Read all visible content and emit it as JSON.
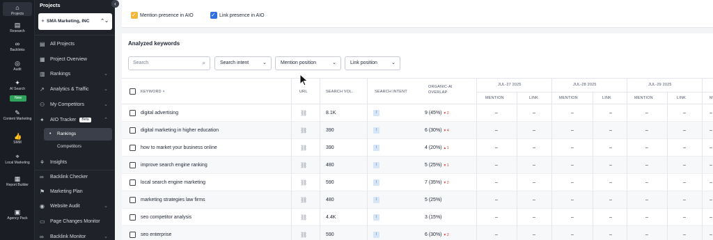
{
  "rail": [
    {
      "label": "Projects",
      "icon": "home-icon",
      "glyph": "⌂"
    },
    {
      "label": "Research",
      "icon": "research-icon",
      "glyph": "▤"
    },
    {
      "label": "Backlinks",
      "icon": "link-icon",
      "glyph": "∞"
    },
    {
      "label": "Audit",
      "icon": "audit-icon",
      "glyph": "◎"
    },
    {
      "label": "AI Search",
      "icon": "sparkle-icon",
      "glyph": "✦"
    },
    {
      "label": "Content Marketing",
      "icon": "content-icon",
      "glyph": "✎"
    },
    {
      "label": "SMM",
      "icon": "thumbs-up-icon",
      "glyph": "👍"
    },
    {
      "label": "Local Marketing",
      "icon": "location-pin-icon",
      "glyph": "⌖"
    },
    {
      "label": "Report Builder",
      "icon": "report-icon",
      "glyph": "▦"
    },
    {
      "label": "Agency Pack",
      "icon": "agency-icon",
      "glyph": "▣"
    }
  ],
  "rail_new_badge": "New",
  "sidebar": {
    "title": "Projects",
    "project": "SMA Marketing, INC",
    "items": [
      {
        "label": "All Projects",
        "icon": "all-projects-icon",
        "glyph": "▤",
        "chevron": false
      },
      {
        "label": "Project Overview",
        "icon": "overview-icon",
        "glyph": "▦",
        "chevron": false
      },
      {
        "label": "Rankings",
        "icon": "rankings-icon",
        "glyph": "▥",
        "chevron": true
      },
      {
        "label": "Analytics & Traffic",
        "icon": "analytics-icon",
        "glyph": "↗",
        "chevron": true
      },
      {
        "label": "My Competitors",
        "icon": "competitors-icon",
        "glyph": "⚇",
        "chevron": true
      },
      {
        "label": "AIO Tracker",
        "icon": "aio-icon",
        "glyph": "✦",
        "chevron": true,
        "badge": "Beta"
      }
    ],
    "sub_items": [
      {
        "label": "Rankings",
        "active": true
      },
      {
        "label": "Competitors",
        "active": false
      }
    ],
    "items2": [
      {
        "label": "Insights",
        "icon": "insights-icon",
        "glyph": "⚘",
        "chevron": false
      },
      {
        "label": "Backlink Checker",
        "icon": "backlink-icon",
        "glyph": "∞",
        "chevron": false
      },
      {
        "label": "Marketing Plan",
        "icon": "plan-icon",
        "glyph": "⚑",
        "chevron": false
      },
      {
        "label": "Website Audit",
        "icon": "website-audit-icon",
        "glyph": "◉",
        "chevron": true
      },
      {
        "label": "Page Changes Monitor",
        "icon": "page-changes-icon",
        "glyph": "▭",
        "chevron": false
      },
      {
        "label": "Backlink Monitor",
        "icon": "backlink-monitor-icon",
        "glyph": "∞",
        "chevron": true
      }
    ]
  },
  "toggles": {
    "mention": "Mention presence in AIO",
    "link": "Link presence in AIO"
  },
  "keywords": {
    "title": "Analyzed keywords",
    "search_placeholder": "Search",
    "filters": [
      "Search intent",
      "Mention position",
      "Link position"
    ],
    "headers": {
      "keyword": "KEYWORD",
      "url": "URL",
      "volume": "SEARCH VOL.",
      "intent": "SEARCH INTENT",
      "overlap": "ORGANIC-AI OVERLAP",
      "mention": "MENTION",
      "link": "LINK"
    },
    "dates": [
      "JUL-27 2025",
      "JUL-28 2025",
      "JUL-29 2025"
    ],
    "rows": [
      {
        "keyword": "digital advertising",
        "volume": "8.1K",
        "intent": "I",
        "overlap": "9 (45%)",
        "delta": "▾ 2"
      },
      {
        "keyword": "digital marketing in higher education",
        "volume": "390",
        "intent": "I",
        "overlap": "6 (30%)",
        "delta": "▾ 4"
      },
      {
        "keyword": "how to market your business online",
        "volume": "390",
        "intent": "I",
        "overlap": "4 (20%)",
        "delta": "▴ 1"
      },
      {
        "keyword": "improve search engine ranking",
        "volume": "480",
        "intent": "I",
        "overlap": "5 (25%)",
        "delta": "▾ 1"
      },
      {
        "keyword": "local search engine marketing",
        "volume": "590",
        "intent": "I",
        "overlap": "7 (35%)",
        "delta": "▾ 2"
      },
      {
        "keyword": "marketing strategies law firms",
        "volume": "480",
        "intent": "I",
        "overlap": "5 (25%)",
        "delta": ""
      },
      {
        "keyword": "seo competitor analysis",
        "volume": "4.4K",
        "intent": "I",
        "overlap": "3 (15%)",
        "delta": ""
      },
      {
        "keyword": "seo enterprise",
        "volume": "590",
        "intent": "I",
        "overlap": "6 (30%)",
        "delta": "▾ 2"
      }
    ],
    "dash": "–"
  },
  "colors": {
    "rail_bg": "#1a1d24",
    "sidebar_bg": "#1f2229",
    "mention_checkbox": "#f2b73b",
    "link_checkbox": "#2f6fe0",
    "delta_down": "#d23b3b"
  }
}
